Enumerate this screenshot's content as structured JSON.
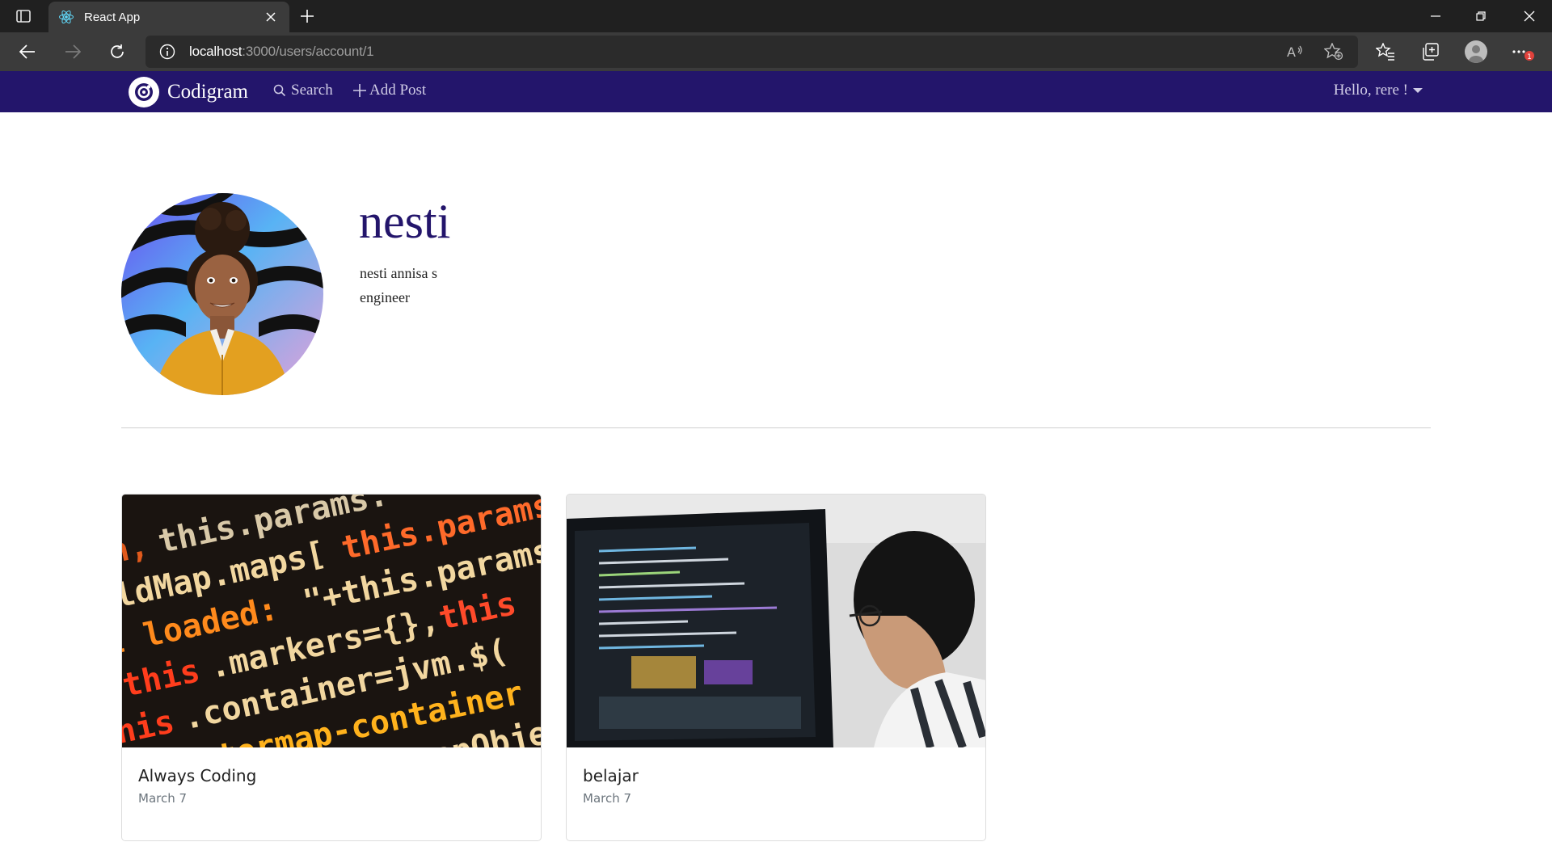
{
  "browser": {
    "tab_title": "React App",
    "url_host": "localhost",
    "url_rest": ":3000/users/account/1",
    "read_aloud_label": "A",
    "notification_badge": "1"
  },
  "navbar": {
    "brand": "Codigram",
    "search_label": "Search",
    "add_post_label": "Add Post",
    "user_greeting": "Hello, rere !"
  },
  "profile": {
    "username": "nesti",
    "full_name": "nesti annisa s",
    "bio": "engineer"
  },
  "posts": [
    {
      "title": "Always Coding",
      "date": "March 7"
    },
    {
      "title": "belajar",
      "date": "March 7"
    }
  ],
  "colors": {
    "navbar_bg": "#23156b",
    "username_color": "#23156b"
  }
}
